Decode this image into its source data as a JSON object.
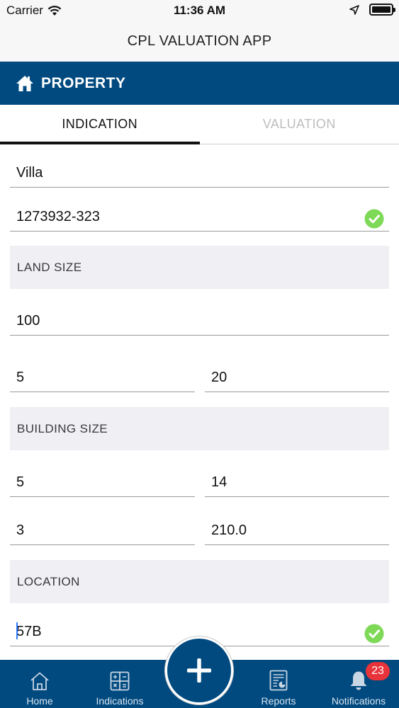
{
  "status_bar": {
    "carrier": "Carrier",
    "time": "11:36 AM",
    "battery_level": 1.0
  },
  "nav": {
    "title": "CPL VALUATION APP"
  },
  "section": {
    "title": "PROPERTY",
    "icon": "home-icon",
    "color": "#004a80"
  },
  "tabs": [
    {
      "label": "INDICATION",
      "active": true
    },
    {
      "label": "VALUATION",
      "active": false
    }
  ],
  "form": {
    "property_type": "Villa",
    "property_id": "1273932-323",
    "property_id_valid": true,
    "land_size_label": "LAND SIZE",
    "land_size": "100",
    "land_size_a": "5",
    "land_size_b": "20",
    "building_size_label": "BUILDING SIZE",
    "building_a": "5",
    "building_b": "14",
    "building_c": "3",
    "building_d": "210.0",
    "location_label": "LOCATION",
    "location_value": "57B",
    "location_valid": true
  },
  "bottom_tabs": {
    "home": "Home",
    "indications": "Indications",
    "reports": "Reports",
    "notifications": "Notifications",
    "notification_count": "23"
  },
  "colors": {
    "brand": "#004a80",
    "success": "#7ed957",
    "badge": "#e8333a"
  }
}
